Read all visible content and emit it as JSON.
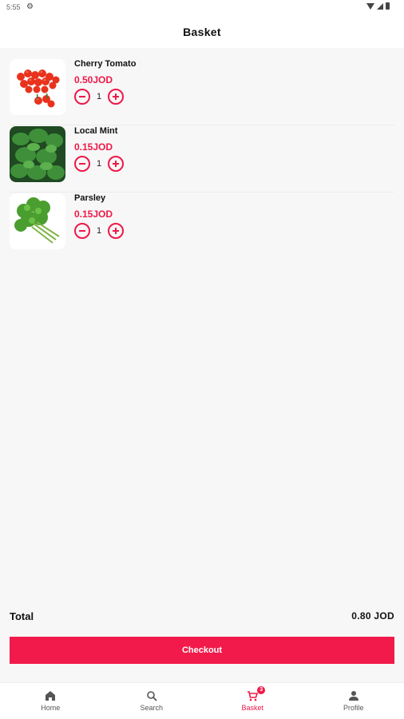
{
  "status_bar": {
    "time": "5:55",
    "icons": [
      "gear-icon",
      "wifi-icon",
      "signal-icon",
      "battery-icon"
    ]
  },
  "header": {
    "title": "Basket"
  },
  "items": [
    {
      "name": "Cherry Tomato",
      "price": "0.50JOD",
      "quantity": "1",
      "image": "cherry-tomato-image"
    },
    {
      "name": "Local Mint",
      "price": "0.15JOD",
      "quantity": "1",
      "image": "mint-image"
    },
    {
      "name": "Parsley",
      "price": "0.15JOD",
      "quantity": "1",
      "image": "parsley-image"
    }
  ],
  "summary": {
    "total_label": "Total",
    "total_value": "0.80 JOD"
  },
  "checkout": {
    "label": "Checkout"
  },
  "nav": {
    "items": [
      {
        "label": "Home",
        "icon": "home-icon"
      },
      {
        "label": "Search",
        "icon": "search-icon"
      },
      {
        "label": "Basket",
        "icon": "cart-icon",
        "badge": "3",
        "active": true
      },
      {
        "label": "Profile",
        "icon": "person-icon"
      }
    ]
  },
  "colors": {
    "accent": "#ef1848",
    "background": "#f7f7f7",
    "surface": "#ffffff"
  }
}
